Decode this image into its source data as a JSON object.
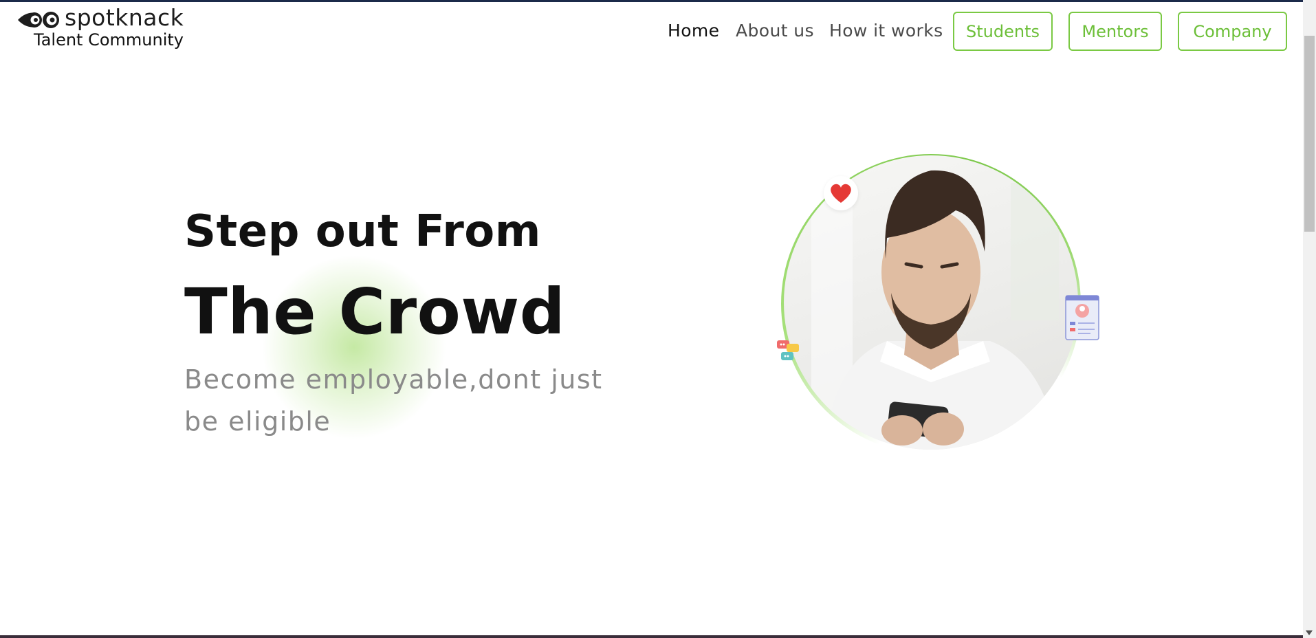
{
  "brand": {
    "name": "spotknack",
    "tagline": "Talent Community"
  },
  "nav": {
    "links": [
      {
        "label": "Home",
        "active": true
      },
      {
        "label": "About us",
        "active": false
      },
      {
        "label": "How it works",
        "active": false
      }
    ],
    "buttons": [
      {
        "label": "Students"
      },
      {
        "label": "Mentors"
      },
      {
        "label": "Company"
      }
    ]
  },
  "hero": {
    "line1": "Step out From",
    "line2": "The Crowd",
    "subtitle": "Become employable,dont just be eligible"
  },
  "colors": {
    "accent": "#7ac943",
    "heart": "#e53935",
    "topline": "#1b2a4a"
  },
  "icons": {
    "heart": "heart-icon",
    "chat": "chat-bubbles-icon",
    "profile": "profile-card-icon"
  }
}
